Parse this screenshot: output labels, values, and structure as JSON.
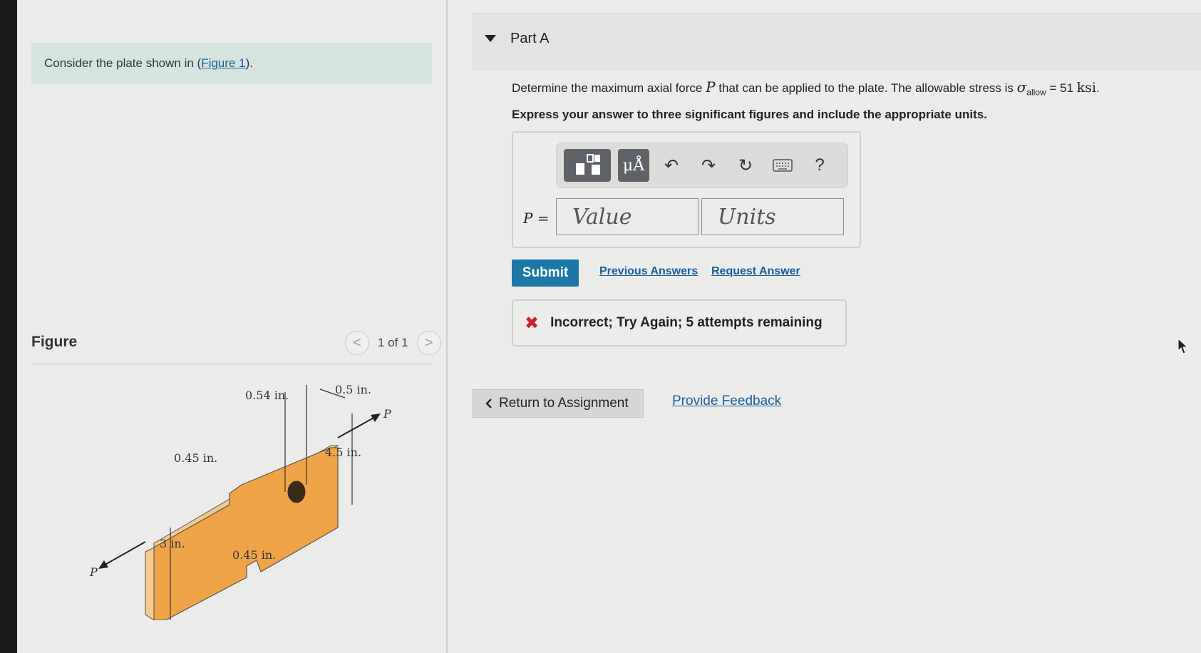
{
  "intro": {
    "text_before": "Consider the plate shown in (",
    "link": "Figure 1",
    "text_after": ")."
  },
  "figure": {
    "title": "Figure",
    "pager": "1 of 1",
    "prev": "<",
    "next": ">",
    "labels": {
      "top_width": "0.54 in.",
      "hole": "0.5 in.",
      "force_right": "P",
      "height_right": "4.5 in.",
      "notch_top": "0.45 in.",
      "height_left": "3 in.",
      "notch_bottom": "0.45 in.",
      "force_left": "P"
    }
  },
  "part": {
    "title": "Part A"
  },
  "question": {
    "seg1": "Determine the maximum axial force ",
    "var_p": "P",
    "seg2": " that can be applied to the plate. The allowable stress is ",
    "sigma": "σ",
    "sigma_sub": "allow",
    "seg3": " = 51 ",
    "unit": "ksi",
    "seg4": ".",
    "instruction": "Express your answer to three significant figures and include the appropriate units."
  },
  "answer": {
    "mu_label": "μÅ",
    "undo": "↶",
    "redo": "↷",
    "reset": "↻",
    "help": "?",
    "p_label": "P =",
    "value_placeholder": "Value",
    "units_placeholder": "Units"
  },
  "actions": {
    "submit": "Submit",
    "previous_answers": "Previous Answers",
    "request_answer": "Request Answer"
  },
  "feedback": {
    "icon": "✖",
    "message": "Incorrect; Try Again; 5 attempts remaining"
  },
  "footer": {
    "return_label": "Return to Assignment",
    "provide_feedback": "Provide Feedback"
  },
  "colors": {
    "plate_face": "#f0a448",
    "plate_edge": "#f6c98e",
    "submit_bg": "#1c77a6",
    "link": "#1a5e9a",
    "error": "#c7242d"
  }
}
